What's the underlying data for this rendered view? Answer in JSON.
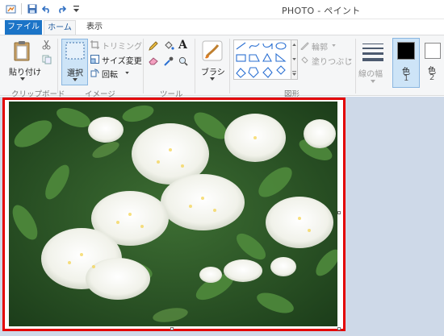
{
  "window": {
    "title": "PHOTO - ペイント"
  },
  "tabs": {
    "file": "ファイル",
    "home": "ホーム",
    "view": "表示"
  },
  "clipboard": {
    "paste": "貼り付け",
    "group": "クリップボード"
  },
  "image": {
    "select": "選択",
    "crop": "トリミング",
    "resize": "サイズ変更",
    "rotate": "回転",
    "group": "イメージ"
  },
  "tools": {
    "group": "ツール",
    "text_glyph": "A"
  },
  "brushes": {
    "label": "ブラシ"
  },
  "shapes": {
    "outline": "輪郭",
    "fill": "塗りつぶし",
    "group": "図形"
  },
  "size": {
    "label": "線の幅"
  },
  "colors": {
    "color1": "色",
    "color1_num": "1",
    "color2": "色",
    "color2_num": "2",
    "color1_value": "#000000",
    "color2_value": "#ffffff"
  },
  "accent": {
    "file_tab": "#1b74c7",
    "selection_border": "#e30000",
    "canvas_bg": "#ced9e8"
  }
}
